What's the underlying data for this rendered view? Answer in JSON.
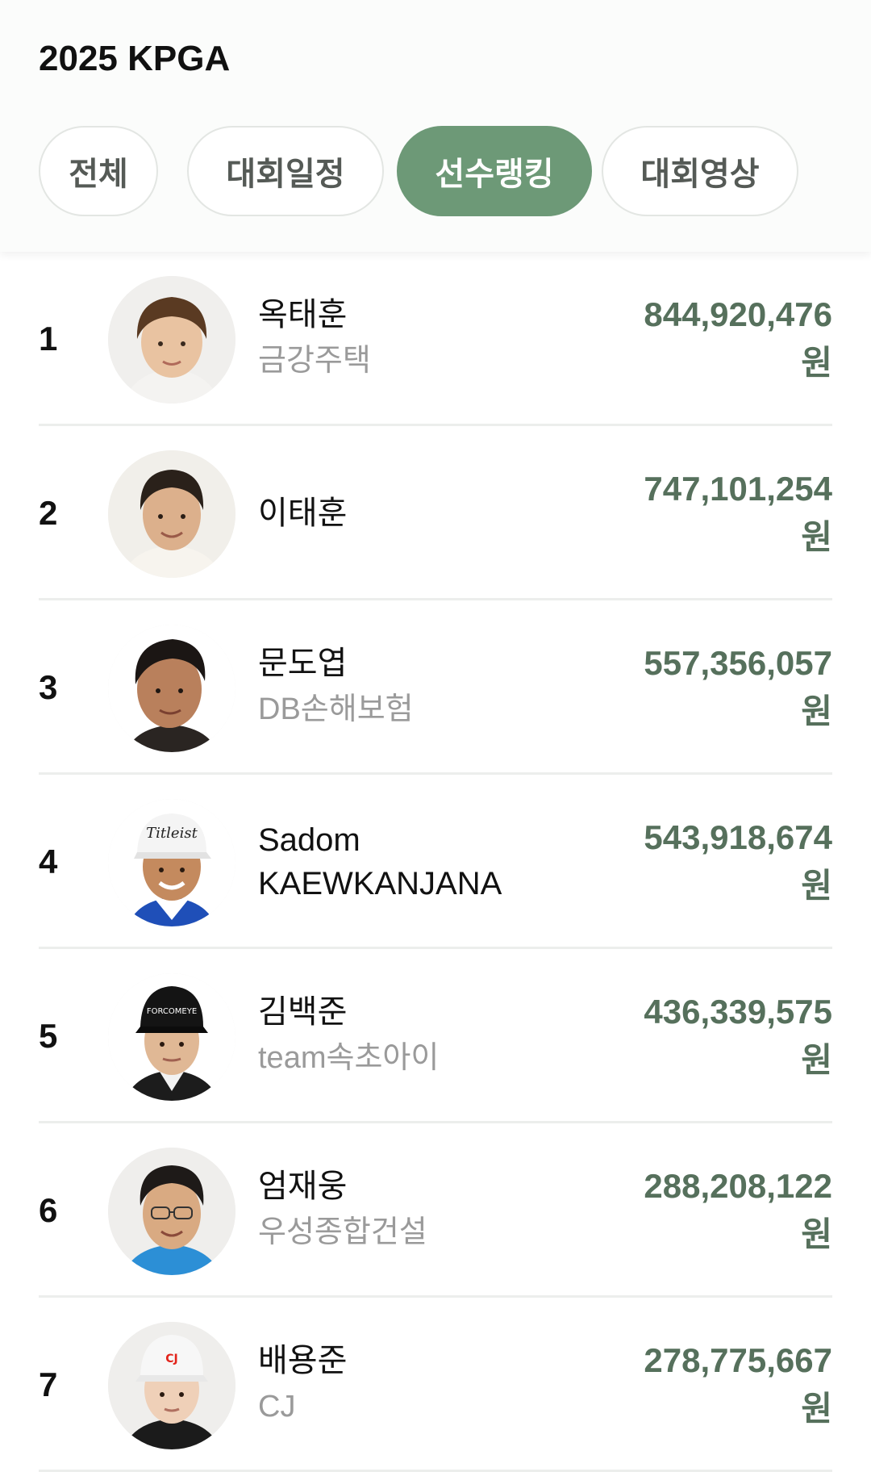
{
  "header": {
    "title": "2025 KPGA",
    "tabs": [
      {
        "label": "전체",
        "active": false
      },
      {
        "label": "대회일정",
        "active": false
      },
      {
        "label": "선수랭킹",
        "active": true
      },
      {
        "label": "대회영상",
        "active": false
      }
    ]
  },
  "theme": {
    "accent": "#6d9977",
    "prize_color": "#56705c",
    "team_color": "#9a9a9a"
  },
  "players": [
    {
      "rank": "1",
      "name": "옥태훈",
      "team": "금강주택",
      "prize": "844,920,476",
      "unit": "원"
    },
    {
      "rank": "2",
      "name": "이태훈",
      "team": "",
      "prize": "747,101,254",
      "unit": "원"
    },
    {
      "rank": "3",
      "name": "문도엽",
      "team": "DB손해보험",
      "prize": "557,356,057",
      "unit": "원"
    },
    {
      "rank": "4",
      "name": "Sadom KAEWKANJANA",
      "team": "",
      "prize": "543,918,674",
      "unit": "원"
    },
    {
      "rank": "5",
      "name": "김백준",
      "team": "team속초아이",
      "prize": "436,339,575",
      "unit": "원"
    },
    {
      "rank": "6",
      "name": "엄재웅",
      "team": "우성종합건설",
      "prize": "288,208,122",
      "unit": "원"
    },
    {
      "rank": "7",
      "name": "배용준",
      "team": "CJ",
      "prize": "278,775,667",
      "unit": "원"
    }
  ]
}
